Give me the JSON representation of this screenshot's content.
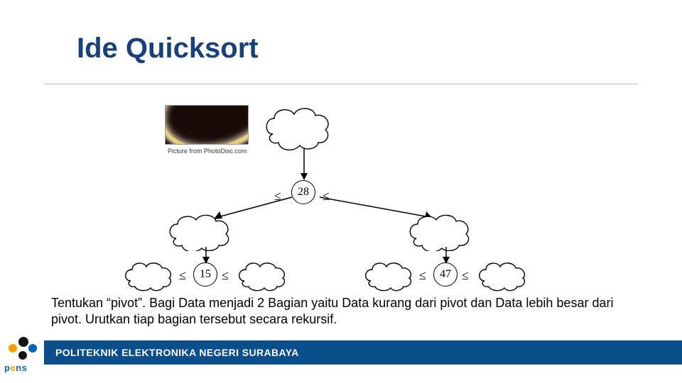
{
  "title": "Ide Quicksort",
  "pic_caption": "Picture from PhotoDisc.com",
  "description": "Tentukan “pivot”. Bagi Data menjadi 2 Bagian yaitu Data kurang dari pivot dan Data lebih besar dari pivot. Urutkan tiap bagian tersebut secara rekursif.",
  "footer": "POLITEKNIK ELEKTRONIKA NEGERI SURABAYA",
  "logo_text_before_e": "p",
  "logo_text_e": "e",
  "logo_text_after_e": "ns",
  "nodes": {
    "root": "28",
    "left": "15",
    "right": "47"
  },
  "lt_symbol": "≤"
}
